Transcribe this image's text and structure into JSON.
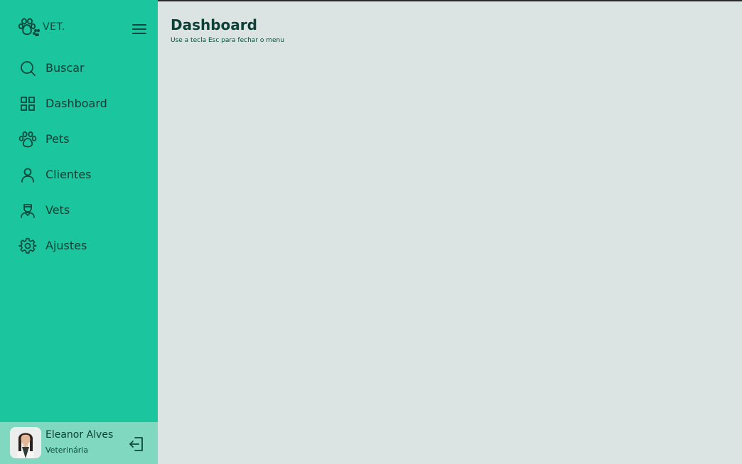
{
  "brand": {
    "logo_text": "VET.",
    "logo_icon": "paw-icon"
  },
  "nav": {
    "items": [
      {
        "label": "Buscar",
        "icon": "search-icon"
      },
      {
        "label": "Dashboard",
        "icon": "grid-icon"
      },
      {
        "label": "Pets",
        "icon": "paw-icon"
      },
      {
        "label": "Clientes",
        "icon": "user-icon"
      },
      {
        "label": "Vets",
        "icon": "vet-icon"
      },
      {
        "label": "Ajustes",
        "icon": "gear-icon"
      }
    ]
  },
  "user": {
    "name": "Eleanor Alves",
    "role": "Veterinária"
  },
  "main": {
    "title": "Dashboard",
    "subtitle": "Use a tecla Esc para fechar o menu"
  },
  "colors": {
    "sidebar": "#1bc59d",
    "user_panel": "#7fd8bf",
    "background": "#dbe4e2",
    "text_dark": "#0c3f35"
  }
}
